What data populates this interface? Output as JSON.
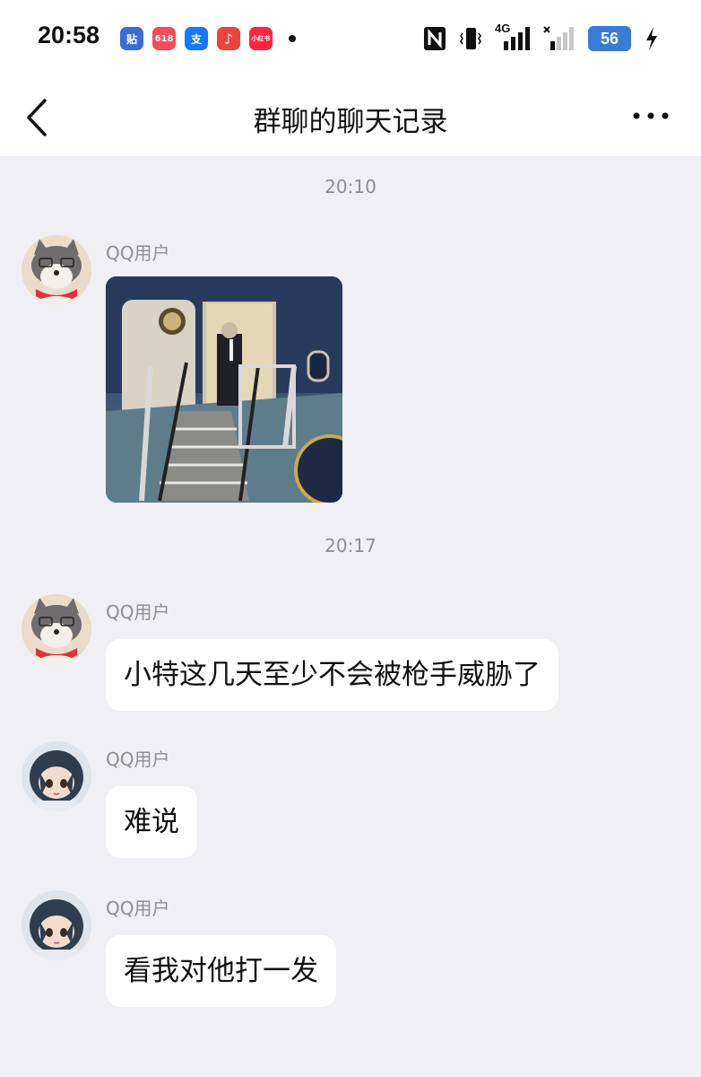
{
  "status_bar": {
    "time": "20:58",
    "app_icons": [
      {
        "name": "tieba-icon",
        "glyph": "贴",
        "color": "#3b6bd8"
      },
      {
        "name": "taobao-618-icon",
        "glyph": "618",
        "color": "#ef4d5a"
      },
      {
        "name": "alipay-icon",
        "glyph": "支",
        "color": "#1677ff"
      },
      {
        "name": "music-icon",
        "glyph": "♪",
        "color": "#e8453c"
      },
      {
        "name": "xiaohongshu-icon",
        "glyph": "小红书",
        "color": "#ff2442"
      }
    ],
    "network_label": "4G",
    "battery_level": "56"
  },
  "header": {
    "title": "群聊的聊天记录"
  },
  "chat": {
    "timestamps": [
      "20:10",
      "20:17"
    ],
    "messages": [
      {
        "sender": "QQ用户",
        "type": "image",
        "avatar": "wolf-avatar"
      },
      {
        "sender": "QQ用户",
        "type": "text",
        "text": "小特这几天至少不会被枪手威胁了",
        "avatar": "wolf-avatar"
      },
      {
        "sender": "QQ用户",
        "type": "text",
        "text": "难说",
        "avatar": "girl-avatar"
      },
      {
        "sender": "QQ用户",
        "type": "text",
        "text": "看我对他打一发",
        "avatar": "girl-avatar"
      }
    ]
  },
  "colors": {
    "background": "#efeff4",
    "bubble": "#ffffff",
    "meta_text": "#8d8d92",
    "battery": "#3a7bd5"
  }
}
